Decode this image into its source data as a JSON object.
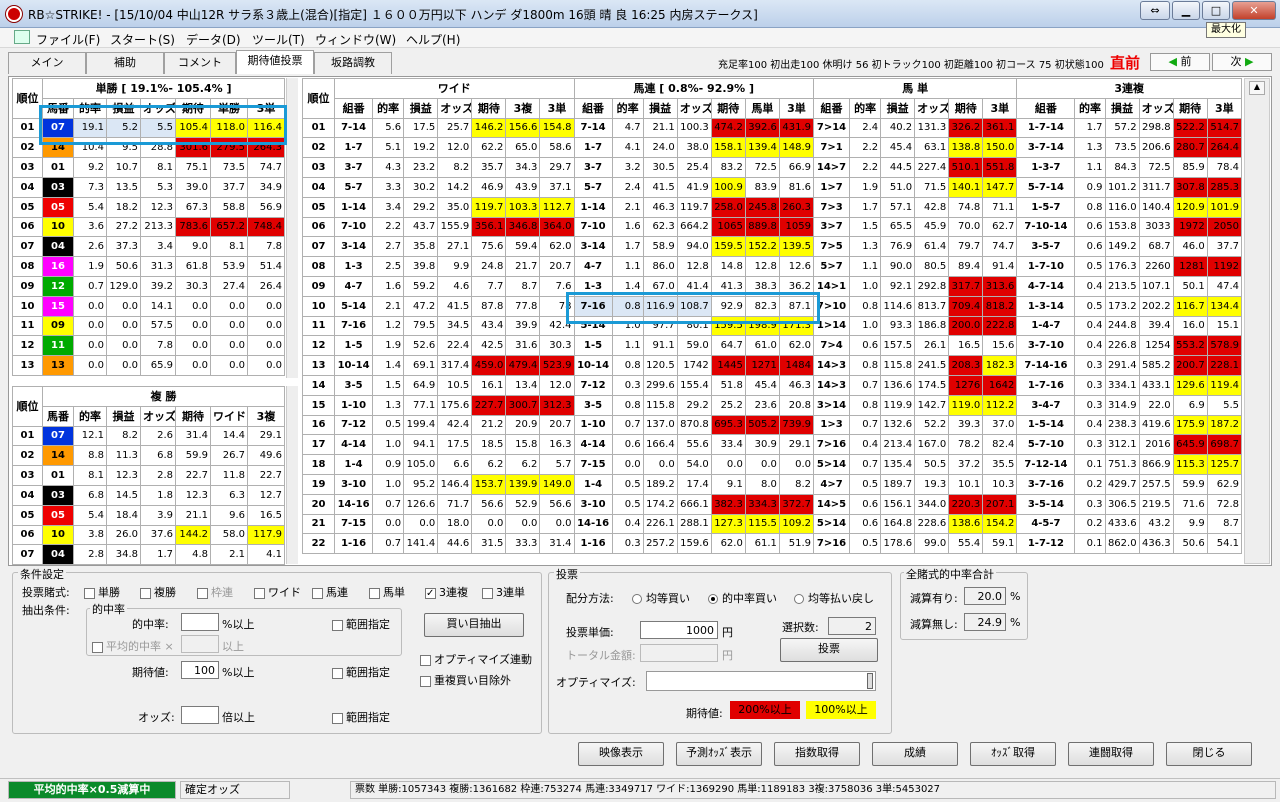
{
  "window": {
    "title": "RB☆STRIKE! - [15/10/04 中山12R サラ系３歳上(混合)[指定] １６００万円以下 ハンデ ダ1800m  16頭 晴 良 16:25 内房ステークス]",
    "tooltip": "最大化"
  },
  "menu": [
    "ファイル(F)",
    "スタート(S)",
    "データ(D)",
    "ツール(T)",
    "ウィンドウ(W)",
    "ヘルプ(H)"
  ],
  "tabs": [
    "メイン",
    "補助",
    "コメント",
    "期待値投票",
    "坂路調教"
  ],
  "stats": "充足率100 初出走100 休明け 56 初トラック100 初距離100 初コース 75 初状態100",
  "chokuzen": "直前",
  "prev": "前",
  "next": "次",
  "rank_label": "順位",
  "tansho": {
    "title": "単勝 [ 19.1%- 105.4% ]",
    "headers": [
      "馬番",
      "的率",
      "損益",
      "オッズ",
      "期待",
      "単勝",
      "3単"
    ],
    "rows": [
      [
        "01",
        "07",
        "19.1",
        "5.2",
        "5.5",
        "105.4",
        "118.0",
        "116.4"
      ],
      [
        "02",
        "14",
        "10.4",
        "9.5",
        "28.8",
        "301.6",
        "279.5",
        "264.3"
      ],
      [
        "03",
        "01",
        "9.2",
        "10.7",
        "8.1",
        "75.1",
        "73.5",
        "74.7"
      ],
      [
        "04",
        "03",
        "7.3",
        "13.5",
        "5.3",
        "39.0",
        "37.7",
        "34.9"
      ],
      [
        "05",
        "05",
        "5.4",
        "18.2",
        "12.3",
        "67.3",
        "58.8",
        "56.9"
      ],
      [
        "06",
        "10",
        "3.6",
        "27.2",
        "213.3",
        "783.6",
        "657.2",
        "748.4"
      ],
      [
        "07",
        "04",
        "2.6",
        "37.3",
        "3.4",
        "9.0",
        "8.1",
        "7.8"
      ],
      [
        "08",
        "16",
        "1.9",
        "50.6",
        "31.3",
        "61.8",
        "53.9",
        "51.4"
      ],
      [
        "09",
        "12",
        "0.7",
        "129.0",
        "39.2",
        "30.3",
        "27.4",
        "26.4"
      ],
      [
        "10",
        "15",
        "0.0",
        "0.0",
        "14.1",
        "0.0",
        "0.0",
        "0.0"
      ],
      [
        "11",
        "09",
        "0.0",
        "0.0",
        "57.5",
        "0.0",
        "0.0",
        "0.0"
      ],
      [
        "12",
        "11",
        "0.0",
        "0.0",
        "7.8",
        "0.0",
        "0.0",
        "0.0"
      ],
      [
        "13",
        "13",
        "0.0",
        "0.0",
        "65.9",
        "0.0",
        "0.0",
        "0.0"
      ]
    ]
  },
  "fukusho": {
    "title": "複 勝",
    "headers": [
      "馬番",
      "的率",
      "損益",
      "オッズ",
      "期待",
      "ワイド",
      "3複"
    ],
    "rows": [
      [
        "01",
        "07",
        "12.1",
        "8.2",
        "2.6",
        "31.4",
        "14.4",
        "29.1"
      ],
      [
        "02",
        "14",
        "8.8",
        "11.3",
        "6.8",
        "59.9",
        "26.7",
        "49.6"
      ],
      [
        "03",
        "01",
        "8.1",
        "12.3",
        "2.8",
        "22.7",
        "11.8",
        "22.7"
      ],
      [
        "04",
        "03",
        "6.8",
        "14.5",
        "1.8",
        "12.3",
        "6.3",
        "12.7"
      ],
      [
        "05",
        "05",
        "5.4",
        "18.4",
        "3.9",
        "21.1",
        "9.6",
        "16.5"
      ],
      [
        "06",
        "10",
        "3.8",
        "26.0",
        "37.6",
        "144.2",
        "58.0",
        "117.9"
      ],
      [
        "07",
        "04",
        "2.8",
        "34.8",
        "1.7",
        "4.8",
        "2.1",
        "4.1"
      ]
    ]
  },
  "wide": {
    "title": "ワイド",
    "headers": [
      "組番",
      "的率",
      "損益",
      "オッズ",
      "期待",
      "3複",
      "3単"
    ],
    "rows": [
      [
        "01",
        "7-14",
        "5.6",
        "17.5",
        "25.7",
        "146.2",
        "156.6",
        "154.8"
      ],
      [
        "02",
        "1-7",
        "5.1",
        "19.2",
        "12.0",
        "62.2",
        "65.0",
        "58.6"
      ],
      [
        "03",
        "3-7",
        "4.3",
        "23.2",
        "8.2",
        "35.7",
        "34.3",
        "29.7"
      ],
      [
        "04",
        "5-7",
        "3.3",
        "30.2",
        "14.2",
        "46.9",
        "43.9",
        "37.1"
      ],
      [
        "05",
        "1-14",
        "3.4",
        "29.2",
        "35.0",
        "119.7",
        "103.3",
        "112.7"
      ],
      [
        "06",
        "7-10",
        "2.2",
        "43.7",
        "155.9",
        "356.1",
        "346.8",
        "364.0"
      ],
      [
        "07",
        "3-14",
        "2.7",
        "35.8",
        "27.1",
        "75.6",
        "59.4",
        "62.0"
      ],
      [
        "08",
        "1-3",
        "2.5",
        "39.8",
        "9.9",
        "24.8",
        "21.7",
        "20.7"
      ],
      [
        "09",
        "4-7",
        "1.6",
        "59.2",
        "4.6",
        "7.7",
        "8.7",
        "7.6"
      ],
      [
        "10",
        "5-14",
        "2.1",
        "47.2",
        "41.5",
        "87.8",
        "77.8",
        "78"
      ],
      [
        "11",
        "7-16",
        "1.2",
        "79.5",
        "34.5",
        "43.4",
        "39.9",
        "42.4"
      ],
      [
        "12",
        "1-5",
        "1.9",
        "52.6",
        "22.4",
        "42.5",
        "31.6",
        "30.3"
      ],
      [
        "13",
        "10-14",
        "1.4",
        "69.1",
        "317.4",
        "459.0",
        "479.4",
        "523.9"
      ],
      [
        "14",
        "3-5",
        "1.5",
        "64.9",
        "10.5",
        "16.1",
        "13.4",
        "12.0"
      ],
      [
        "15",
        "1-10",
        "1.3",
        "77.1",
        "175.6",
        "227.7",
        "300.7",
        "312.3"
      ],
      [
        "16",
        "7-12",
        "0.5",
        "199.4",
        "42.4",
        "21.2",
        "20.9",
        "20.7"
      ],
      [
        "17",
        "4-14",
        "1.0",
        "94.1",
        "17.5",
        "18.5",
        "15.8",
        "16.3"
      ],
      [
        "18",
        "1-4",
        "0.9",
        "105.0",
        "6.6",
        "6.2",
        "6.2",
        "5.7"
      ],
      [
        "19",
        "3-10",
        "1.0",
        "95.2",
        "146.4",
        "153.7",
        "139.9",
        "149.0"
      ],
      [
        "20",
        "14-16",
        "0.7",
        "126.6",
        "71.7",
        "56.6",
        "52.9",
        "56.6"
      ],
      [
        "21",
        "7-15",
        "0.0",
        "0.0",
        "18.0",
        "0.0",
        "0.0",
        "0.0"
      ],
      [
        "22",
        "1-16",
        "0.7",
        "141.4",
        "44.6",
        "31.5",
        "33.3",
        "31.4"
      ]
    ]
  },
  "umaren": {
    "title": "馬連 [ 0.8%- 92.9% ]",
    "headers": [
      "組番",
      "的率",
      "損益",
      "オッズ",
      "期待",
      "馬単",
      "3単"
    ],
    "rows": [
      [
        "7-14",
        "4.7",
        "21.1",
        "100.3",
        "474.2",
        "392.6",
        "431.9"
      ],
      [
        "1-7",
        "4.1",
        "24.0",
        "38.0",
        "158.1",
        "139.4",
        "148.9"
      ],
      [
        "3-7",
        "3.2",
        "30.5",
        "25.4",
        "83.2",
        "72.5",
        "66.9"
      ],
      [
        "5-7",
        "2.4",
        "41.5",
        "41.9",
        "100.9",
        "83.9",
        "81.6"
      ],
      [
        "1-14",
        "2.1",
        "46.3",
        "119.7",
        "258.0",
        "245.8",
        "260.3"
      ],
      [
        "7-10",
        "1.6",
        "62.3",
        "664.2",
        "1065",
        "889.8",
        "1059"
      ],
      [
        "3-14",
        "1.7",
        "58.9",
        "94.0",
        "159.5",
        "152.2",
        "139.5"
      ],
      [
        "4-7",
        "1.1",
        "86.0",
        "12.8",
        "14.8",
        "12.8",
        "12.6"
      ],
      [
        "1-3",
        "1.4",
        "67.0",
        "41.4",
        "41.3",
        "38.3",
        "36.2"
      ],
      [
        "7-16",
        "0.8",
        "116.9",
        "108.7",
        "92.9",
        "82.3",
        "87.1"
      ],
      [
        "5-14",
        "1.0",
        "97.7",
        "80.1",
        "159.5",
        "198.9",
        "171.3"
      ],
      [
        "1-5",
        "1.1",
        "91.1",
        "59.0",
        "64.7",
        "61.0",
        "62.0"
      ],
      [
        "10-14",
        "0.8",
        "120.5",
        "1742",
        "1445",
        "1271",
        "1484"
      ],
      [
        "7-12",
        "0.3",
        "299.6",
        "155.4",
        "51.8",
        "45.4",
        "46.3"
      ],
      [
        "3-5",
        "0.8",
        "115.8",
        "29.2",
        "25.2",
        "23.6",
        "20.8"
      ],
      [
        "1-10",
        "0.7",
        "137.0",
        "870.8",
        "695.3",
        "505.2",
        "739.9"
      ],
      [
        "4-14",
        "0.6",
        "166.4",
        "55.6",
        "33.4",
        "30.9",
        "29.1"
      ],
      [
        "7-15",
        "0.0",
        "0.0",
        "54.0",
        "0.0",
        "0.0",
        "0.0"
      ],
      [
        "1-4",
        "0.5",
        "189.2",
        "17.4",
        "9.1",
        "8.0",
        "8.2"
      ],
      [
        "3-10",
        "0.5",
        "174.2",
        "666.1",
        "382.3",
        "334.3",
        "372.7"
      ],
      [
        "14-16",
        "0.4",
        "226.1",
        "288.1",
        "127.3",
        "115.5",
        "109.2"
      ],
      [
        "1-16",
        "0.3",
        "257.2",
        "159.6",
        "62.0",
        "61.1",
        "51.9"
      ]
    ]
  },
  "umatan": {
    "title": "馬 単",
    "headers": [
      "組番",
      "的率",
      "損益",
      "オッズ",
      "期待",
      "3単"
    ],
    "rows": [
      [
        "7>14",
        "2.4",
        "40.2",
        "131.3",
        "326.2",
        "361.1"
      ],
      [
        "7>1",
        "2.2",
        "45.4",
        "63.1",
        "138.8",
        "150.0"
      ],
      [
        "14>7",
        "2.2",
        "44.5",
        "227.4",
        "510.1",
        "551.8"
      ],
      [
        "1>7",
        "1.9",
        "51.0",
        "71.5",
        "140.1",
        "147.7"
      ],
      [
        "7>3",
        "1.7",
        "57.1",
        "42.8",
        "74.8",
        "71.1"
      ],
      [
        "3>7",
        "1.5",
        "65.5",
        "45.9",
        "70.0",
        "62.7"
      ],
      [
        "7>5",
        "1.3",
        "76.9",
        "61.4",
        "79.7",
        "74.7"
      ],
      [
        "5>7",
        "1.1",
        "90.0",
        "80.5",
        "89.4",
        "91.4"
      ],
      [
        "14>1",
        "1.0",
        "92.1",
        "292.8",
        "317.7",
        "313.6"
      ],
      [
        "7>10",
        "0.8",
        "114.6",
        "813.7",
        "709.4",
        "818.2"
      ],
      [
        "1>14",
        "1.0",
        "93.3",
        "186.8",
        "200.0",
        "222.8"
      ],
      [
        "7>4",
        "0.6",
        "157.5",
        "26.1",
        "16.5",
        "15.6"
      ],
      [
        "14>3",
        "0.8",
        "115.8",
        "241.5",
        "208.3",
        "182.3"
      ],
      [
        "14>3",
        "0.7",
        "136.6",
        "174.5",
        "1276",
        "1642"
      ],
      [
        "3>14",
        "0.8",
        "119.9",
        "142.7",
        "119.0",
        "112.2"
      ],
      [
        "1>3",
        "0.7",
        "132.6",
        "52.2",
        "39.3",
        "37.0"
      ],
      [
        "7>16",
        "0.4",
        "213.4",
        "167.0",
        "78.2",
        "82.4"
      ],
      [
        "5>14",
        "0.7",
        "135.4",
        "50.5",
        "37.2",
        "35.5"
      ],
      [
        "4>7",
        "0.5",
        "189.7",
        "19.3",
        "10.1",
        "10.3"
      ],
      [
        "14>5",
        "0.6",
        "156.1",
        "344.0",
        "220.3",
        "207.1"
      ],
      [
        "5>14",
        "0.6",
        "164.8",
        "228.6",
        "138.6",
        "154.2"
      ],
      [
        "7>16",
        "0.5",
        "178.6",
        "99.0",
        "55.4",
        "59.1"
      ]
    ]
  },
  "sanrenpuku": {
    "title": "3連複",
    "headers": [
      "組番",
      "的率",
      "損益",
      "オッズ",
      "期待",
      "3単"
    ],
    "rows": [
      [
        "1-7-14",
        "1.7",
        "57.2",
        "298.8",
        "522.2",
        "514.7"
      ],
      [
        "3-7-14",
        "1.3",
        "73.5",
        "206.6",
        "280.7",
        "264.4"
      ],
      [
        "1-3-7",
        "1.1",
        "84.3",
        "72.5",
        "85.9",
        "78.4"
      ],
      [
        "5-7-14",
        "0.9",
        "101.2",
        "311.7",
        "307.8",
        "285.3"
      ],
      [
        "1-5-7",
        "0.8",
        "116.0",
        "140.4",
        "120.9",
        "101.9"
      ],
      [
        "7-10-14",
        "0.6",
        "153.8",
        "3033",
        "1972",
        "2050"
      ],
      [
        "3-5-7",
        "0.6",
        "149.2",
        "68.7",
        "46.0",
        "37.7"
      ],
      [
        "1-7-10",
        "0.5",
        "176.3",
        "2260",
        "1281",
        "1192"
      ],
      [
        "4-7-14",
        "0.4",
        "213.5",
        "107.1",
        "50.1",
        "47.4"
      ],
      [
        "1-3-14",
        "0.5",
        "173.2",
        "202.2",
        "116.7",
        "134.4"
      ],
      [
        "1-4-7",
        "0.4",
        "244.8",
        "39.4",
        "16.0",
        "15.1"
      ],
      [
        "3-7-10",
        "0.4",
        "226.8",
        "1254",
        "553.2",
        "578.9"
      ],
      [
        "7-14-16",
        "0.3",
        "291.4",
        "585.2",
        "200.7",
        "228.1"
      ],
      [
        "1-7-16",
        "0.3",
        "334.1",
        "433.1",
        "129.6",
        "119.4"
      ],
      [
        "3-4-7",
        "0.3",
        "314.9",
        "22.0",
        "6.9",
        "5.5"
      ],
      [
        "1-5-14",
        "0.4",
        "238.3",
        "419.6",
        "175.9",
        "187.2"
      ],
      [
        "5-7-10",
        "0.3",
        "312.1",
        "2016",
        "645.9",
        "698.7"
      ],
      [
        "7-12-14",
        "0.1",
        "751.3",
        "866.9",
        "115.3",
        "125.7"
      ],
      [
        "3-7-16",
        "0.2",
        "429.7",
        "257.5",
        "59.9",
        "62.9"
      ],
      [
        "3-5-14",
        "0.3",
        "306.5",
        "219.5",
        "71.6",
        "72.8"
      ],
      [
        "4-5-7",
        "0.2",
        "433.6",
        "43.2",
        "9.9",
        "8.7"
      ],
      [
        "1-7-12",
        "0.1",
        "862.0",
        "436.3",
        "50.6",
        "54.1"
      ]
    ]
  },
  "conditions": {
    "title": "条件設定",
    "bet_label": "投票賭式:",
    "bets": [
      "単勝",
      "複勝",
      "枠連",
      "ワイド",
      "馬連",
      "馬単",
      "3連複",
      "3連単"
    ],
    "extract_label": "抽出条件:",
    "hit_group": "的中率",
    "hit_label": "的中率:",
    "hit_unit": "%以上",
    "avg_label": "平均的中率 ×",
    "avg_unit": "以上",
    "range_label": "範囲指定",
    "ev_label": "期待値:",
    "ev_value": "100",
    "ev_unit": "%以上",
    "odds_label": "オッズ:",
    "odds_unit": "倍以上",
    "extract_btn": "買い目抽出",
    "opt_link": "オプティマイズ連動",
    "no_dup": "重複買い目除外"
  },
  "vote": {
    "title": "投票",
    "method_label": "配分方法:",
    "methods": [
      "均等買い",
      "的中率買い",
      "均等払い戻し"
    ],
    "unit_label": "投票単価:",
    "unit_value": "1000",
    "yen": "円",
    "total_label": "トータル金額:",
    "count_label": "選択数:",
    "count_value": "2",
    "vote_btn": "投票",
    "opt_label": "オプティマイズ:",
    "ev_legend": "期待値:",
    "legend_red": "200%以上",
    "legend_yellow": "100%以上"
  },
  "total": {
    "title": "全賭式的中率合計",
    "with_label": "減算有り:",
    "with_value": "20.0",
    "without_label": "減算無し:",
    "without_value": "24.9",
    "pct": "%"
  },
  "buttons": [
    "映像表示",
    "予測ｵｯｽﾞ表示",
    "指数取得",
    "成績",
    "ｵｯｽﾞ取得",
    "連闘取得",
    "閉じる"
  ],
  "status": {
    "mode": "平均的中率×0.5減算中",
    "fixed": "確定オッズ",
    "counts": "票数  単勝:1057343  複勝:1361682  枠連:753274  馬連:3349717  ワイド:1369290  馬単:1189183  3複:3758036  3単:5453027"
  },
  "colors": {
    "red": "#e00000",
    "yellow": "#ffff00",
    "highlight_box": "#1a9ad6"
  }
}
